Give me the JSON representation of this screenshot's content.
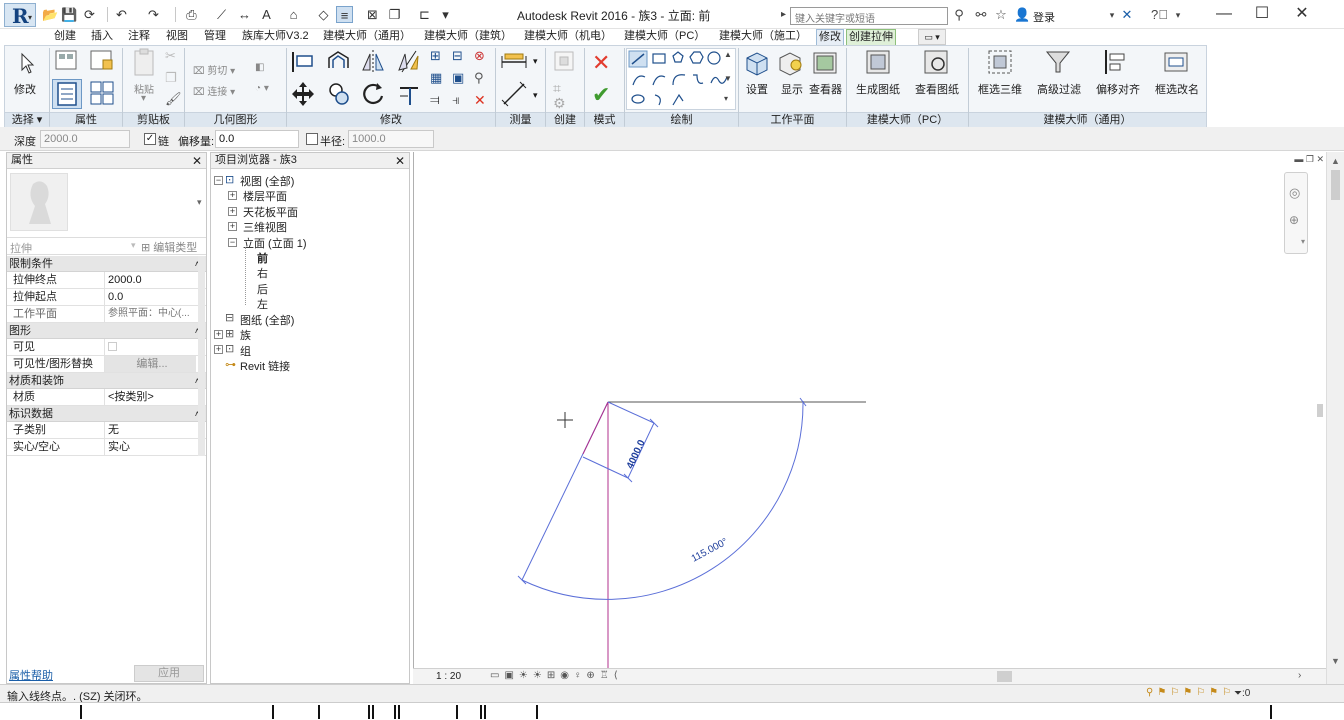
{
  "window": {
    "title": "Autodesk Revit 2016 -    族3 - 立面: 前",
    "search_placeholder": "键入关键字或短语",
    "login_label": "登录",
    "controls": {
      "minimize": "—",
      "maximize": "☐",
      "close": "✕"
    }
  },
  "tabs": [
    {
      "label": "创建"
    },
    {
      "label": "插入"
    },
    {
      "label": "注释"
    },
    {
      "label": "视图"
    },
    {
      "label": "管理"
    },
    {
      "label": "族库大师V3.2"
    },
    {
      "label": "建模大师（通用）"
    },
    {
      "label": "建模大师（建筑）"
    },
    {
      "label": "建模大师（机电）"
    },
    {
      "label": "建模大师（PC）"
    },
    {
      "label": "建模大师（施工）"
    },
    {
      "label": "修改"
    },
    {
      "label": "创建拉伸"
    }
  ],
  "ribbon": {
    "modify_label": "修改",
    "paste_label": "粘贴",
    "cut_label": "剪切",
    "join_label": "连接",
    "groups": {
      "select": "选择",
      "properties": "属性",
      "clipboard": "剪贴板",
      "geometry": "几何图形",
      "modify": "修改",
      "measure": "测量",
      "create": "创建",
      "mode": "模式",
      "draw": "绘制",
      "work_plane": "工作平面",
      "modeling_pc": "建模大师（PC）",
      "modeling_general": "建模大师（通用）"
    },
    "work_plane_buttons": [
      {
        "label": "设置"
      },
      {
        "label": "显示"
      },
      {
        "label": "查看器"
      }
    ],
    "pc_buttons": [
      {
        "label": "生成图纸"
      },
      {
        "label": "查看图纸"
      }
    ],
    "general_buttons": [
      {
        "label": "框选三维"
      },
      {
        "label": "高级过滤"
      },
      {
        "label": "偏移对齐"
      },
      {
        "label": "框选改名"
      }
    ]
  },
  "options_bar": {
    "depth_label": "深度",
    "depth_value": "2000.0",
    "chain_label": "链",
    "chain_checked": true,
    "offset_label": "偏移量:",
    "offset_value": "0.0",
    "radius_label": "半径:",
    "radius_value": "1000.0",
    "radius_checked": false
  },
  "properties": {
    "title": "属性",
    "type_name": "拉伸",
    "edit_type": "编辑类型",
    "sections": [
      {
        "name": "限制条件",
        "rows": [
          {
            "key": "拉伸终点",
            "value": "2000.0"
          },
          {
            "key": "拉伸起点",
            "value": "0.0"
          },
          {
            "key": "工作平面",
            "value": "参照平面：中心(..."
          }
        ]
      },
      {
        "name": "图形",
        "rows": [
          {
            "key": "可见",
            "value": ""
          },
          {
            "key": "可见性/图形替换",
            "value": "编辑..."
          }
        ]
      },
      {
        "name": "材质和装饰",
        "rows": [
          {
            "key": "材质",
            "value": "<按类别>"
          }
        ]
      },
      {
        "name": "标识数据",
        "rows": [
          {
            "key": "子类别",
            "value": "无"
          },
          {
            "key": "实心/空心",
            "value": "实心"
          }
        ]
      }
    ],
    "help_link": "属性帮助",
    "apply_label": "应用"
  },
  "project_browser": {
    "title": "项目浏览器 - 族3",
    "tree": {
      "views": "视图 (全部)",
      "floor_plans": "楼层平面",
      "ceiling_plans": "天花板平面",
      "views_3d": "三维视图",
      "elevations": "立面 (立面 1)",
      "front": "前",
      "right": "右",
      "back": "后",
      "left": "左",
      "sheets": "图纸 (全部)",
      "families": "族",
      "groups": "组",
      "revit_links": "Revit 链接"
    }
  },
  "canvas": {
    "dim_length": "4000.0",
    "dim_angle": "115.000°"
  },
  "view_control": {
    "scale": "1 : 20"
  },
  "status": {
    "message": "输入线终点。. (SZ) 关闭环。",
    "filter_count": ":0"
  },
  "colors": {
    "sketch_line": "#5b6fd8",
    "ref_plane": "#b0308c",
    "ribbon_bg": "#f3f6f9",
    "accent": "#13427f"
  }
}
